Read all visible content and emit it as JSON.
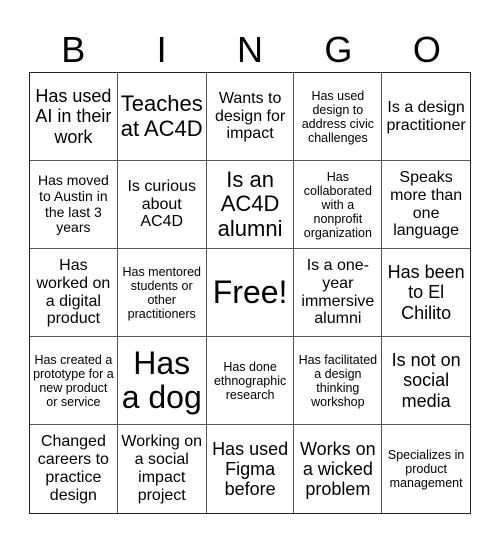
{
  "header": [
    "B",
    "I",
    "N",
    "G",
    "O"
  ],
  "cells": [
    "Has used AI in their work",
    "Teaches at AC4D",
    "Wants to design for impact",
    "Has used design to address civic challenges",
    "Is a design practitioner",
    "Has moved to Austin in the last 3 years",
    "Is curious about AC4D",
    "Is an AC4D alumni",
    "Has collaborated with a nonprofit organization",
    "Speaks more than one language",
    "Has worked on a digital product",
    "Has mentored students or other practitioners",
    "Free!",
    "Is a one-year immersive alumni",
    "Has been to El Chilito",
    "Has created a prototype for a new product or service",
    "Has a dog",
    "Has done ethnographic research",
    "Has facilitated a design thinking workshop",
    "Is not on social media",
    "Changed careers to practice design",
    "Working on a social impact project",
    "Has used Figma before",
    "Works on a wicked problem",
    "Specializes in product management"
  ]
}
